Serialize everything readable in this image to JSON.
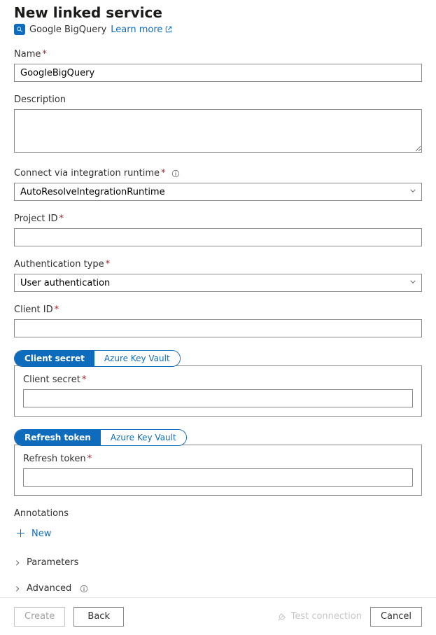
{
  "header": {
    "title": "New linked service",
    "service_name": "Google BigQuery",
    "learn_more": "Learn more"
  },
  "form": {
    "name": {
      "label": "Name",
      "value": "GoogleBigQuery"
    },
    "description": {
      "label": "Description",
      "value": ""
    },
    "runtime": {
      "label": "Connect via integration runtime",
      "selected": "AutoResolveIntegrationRuntime"
    },
    "project_id": {
      "label": "Project ID",
      "value": ""
    },
    "auth_type": {
      "label": "Authentication type",
      "selected": "User authentication"
    },
    "client_id": {
      "label": "Client ID",
      "value": ""
    },
    "client_secret": {
      "tab_secret": "Client secret",
      "tab_akv": "Azure Key Vault",
      "inner_label": "Client secret",
      "value": ""
    },
    "refresh_token": {
      "tab_secret": "Refresh token",
      "tab_akv": "Azure Key Vault",
      "inner_label": "Refresh token",
      "value": ""
    },
    "annotations": {
      "label": "Annotations",
      "new": "New"
    },
    "parameters": {
      "label": "Parameters"
    },
    "advanced": {
      "label": "Advanced"
    }
  },
  "footer": {
    "create": "Create",
    "back": "Back",
    "test": "Test connection",
    "cancel": "Cancel"
  }
}
